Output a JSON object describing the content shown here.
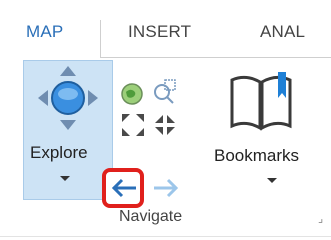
{
  "tabs": [
    {
      "label": "MAP",
      "active": true
    },
    {
      "label": "INSERT",
      "active": false
    },
    {
      "label": "ANAL",
      "active": false
    }
  ],
  "group": {
    "label": "Navigate",
    "explore": {
      "label": "Explore",
      "icon": "pan-arrows-globe-icon"
    },
    "bookmarks": {
      "label": "Bookmarks",
      "icon": "book-bookmark-icon"
    },
    "small_buttons": [
      {
        "name": "full-extent",
        "icon": "globe-icon"
      },
      {
        "name": "zoom-to-selection",
        "icon": "zoom-magnifier-icon"
      },
      {
        "name": "fixed-zoom-in",
        "icon": "arrows-in-icon"
      },
      {
        "name": "fixed-zoom-out",
        "icon": "arrows-out-icon"
      },
      {
        "name": "previous-extent",
        "icon": "back-arrow-icon",
        "highlighted": true
      },
      {
        "name": "next-extent",
        "icon": "forward-arrow-icon"
      }
    ],
    "launcher_glyph": "⌟"
  },
  "colors": {
    "accent": "#2a6fb8",
    "highlight": "#e0201c",
    "hover_fill": "#cde3f5"
  }
}
